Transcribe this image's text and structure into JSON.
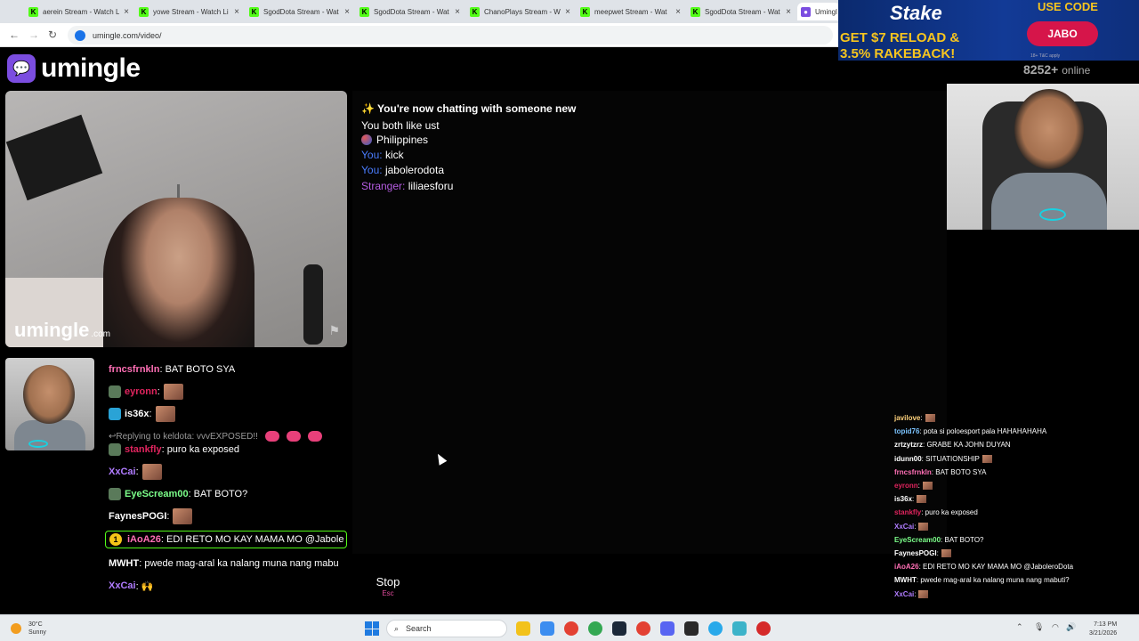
{
  "browser": {
    "tabs": [
      {
        "label": "aerein Stream - Watch L"
      },
      {
        "label": "yowe Stream - Watch Li"
      },
      {
        "label": "SgodDota Stream - Wat"
      },
      {
        "label": "SgodDota Stream - Wat"
      },
      {
        "label": "ChanoPlays Stream - W"
      },
      {
        "label": "meepwet Stream - Wat"
      },
      {
        "label": "SgodDota Stream - Wat"
      },
      {
        "label": "Umingl"
      }
    ],
    "tab_close": "×",
    "url": "umingle.com/video/"
  },
  "site": {
    "logo_text": "umingle",
    "watermark": "umingle",
    "watermark_suffix": ".com"
  },
  "chat": {
    "header": "✨ You're now chatting with someone new",
    "interests": "You both like ust",
    "country": "Philippines",
    "messages": [
      {
        "who": "You:",
        "text": "kick"
      },
      {
        "who": "You:",
        "text": "jabolerodota"
      },
      {
        "who": "Stranger:",
        "text": "liliaesforu"
      }
    ],
    "stop_label": "Stop",
    "stop_key": "Esc",
    "input_value": ""
  },
  "stream_chat_left": {
    "rows": [
      {
        "name": "frncsfrnkln",
        "color": "#ff6fb5",
        "msg": ": BAT BOTO SYA",
        "emote": false,
        "avatar": false
      },
      {
        "name": "eyronn",
        "color": "#e0245e",
        "msg": ":",
        "emote": true,
        "avatar": true
      },
      {
        "name": "is36x",
        "color": "#ffffff",
        "msg": ":",
        "emote": true,
        "avatar": true
      },
      {
        "name": "Replying to keldota: vvvEXPOSED!!",
        "color": "#999999",
        "msg": "",
        "emote": false,
        "avatar": false
      },
      {
        "name": "stankfly",
        "color": "#e0245e",
        "msg": ": puro ka exposed",
        "emote": false,
        "avatar": true
      },
      {
        "name": "XxCai",
        "color": "#b07cff",
        "msg": ":",
        "emote": true,
        "avatar": false
      },
      {
        "name": "EyeScream00",
        "color": "#7cff8a",
        "msg": ": BAT BOTO?",
        "emote": false,
        "avatar": true
      },
      {
        "name": "FaynesPOGI",
        "color": "#ffffff",
        "msg": ":",
        "emote": true,
        "avatar": false
      }
    ],
    "highlight": {
      "coin": "1",
      "name": "iAoA26",
      "msg": ": EDI RETO MO KAY MAMA MO @Jabole"
    },
    "tail": [
      {
        "name": "MWHT",
        "color": "#ffffff",
        "msg": ": pwede mag-aral ka nalang muna nang mabu"
      },
      {
        "name": "XxCai",
        "color": "#b07cff",
        "msg": ": 🙌"
      }
    ]
  },
  "ad": {
    "brand": "Stake",
    "headline_1": "GET $7 RELOAD &",
    "headline_2": "3.5% RAKEBACK!",
    "code_label": "USE CODE",
    "code": "JABO",
    "fine_print": "18+ T&C apply"
  },
  "online": {
    "count": "8252+",
    "label": "online"
  },
  "stream_chat_right": {
    "rows": [
      {
        "name": "javilove",
        "color": "#ffd27c",
        "msg": ":",
        "emote": true
      },
      {
        "name": "topid76",
        "color": "#7cc4ff",
        "msg": ": pota si poloesport pala HAHAHAHAHA",
        "emote": false
      },
      {
        "name": "zrtzytzrz",
        "color": "#ffffff",
        "msg": ": GRABE KA JOHN DUYAN",
        "emote": false
      },
      {
        "name": "idunn00",
        "color": "#ffffff",
        "msg": ": SITUATIONSHIP",
        "emote": true
      },
      {
        "name": "frncsfrnkln",
        "color": "#ff6fb5",
        "msg": ": BAT BOTO SYA",
        "emote": false
      },
      {
        "name": "eyronn",
        "color": "#e0245e",
        "msg": ":",
        "emote": true
      },
      {
        "name": "is36x",
        "color": "#ffffff",
        "msg": ":",
        "emote": true
      },
      {
        "name": "stankfly",
        "color": "#e0245e",
        "msg": ": puro ka exposed",
        "emote": false
      },
      {
        "name": "XxCai",
        "color": "#b07cff",
        "msg": ":",
        "emote": true
      },
      {
        "name": "EyeScream00",
        "color": "#7cff8a",
        "msg": ": BAT BOTO?",
        "emote": false
      },
      {
        "name": "FaynesPOGI",
        "color": "#ffffff",
        "msg": ":",
        "emote": true
      },
      {
        "name": "iAoA26",
        "color": "#ff6fb5",
        "msg": ": EDI RETO MO KAY MAMA MO @JaboleroDota",
        "emote": false
      },
      {
        "name": "MWHT",
        "color": "#ffffff",
        "msg": ": pwede mag-aral ka nalang muna nang mabuti?",
        "emote": false
      },
      {
        "name": "XxCai",
        "color": "#b07cff",
        "msg": ":",
        "emote": true
      }
    ]
  },
  "taskbar": {
    "weather_temp": "30°C",
    "weather_desc": "Sunny",
    "search_label": "Search",
    "time": "7:13 PM",
    "date": "3/21/2026"
  },
  "colors": {
    "you": "#4a7dff",
    "stranger": "#b45ce0",
    "brand": "#7b4de0",
    "kick_green": "#53fc18"
  }
}
